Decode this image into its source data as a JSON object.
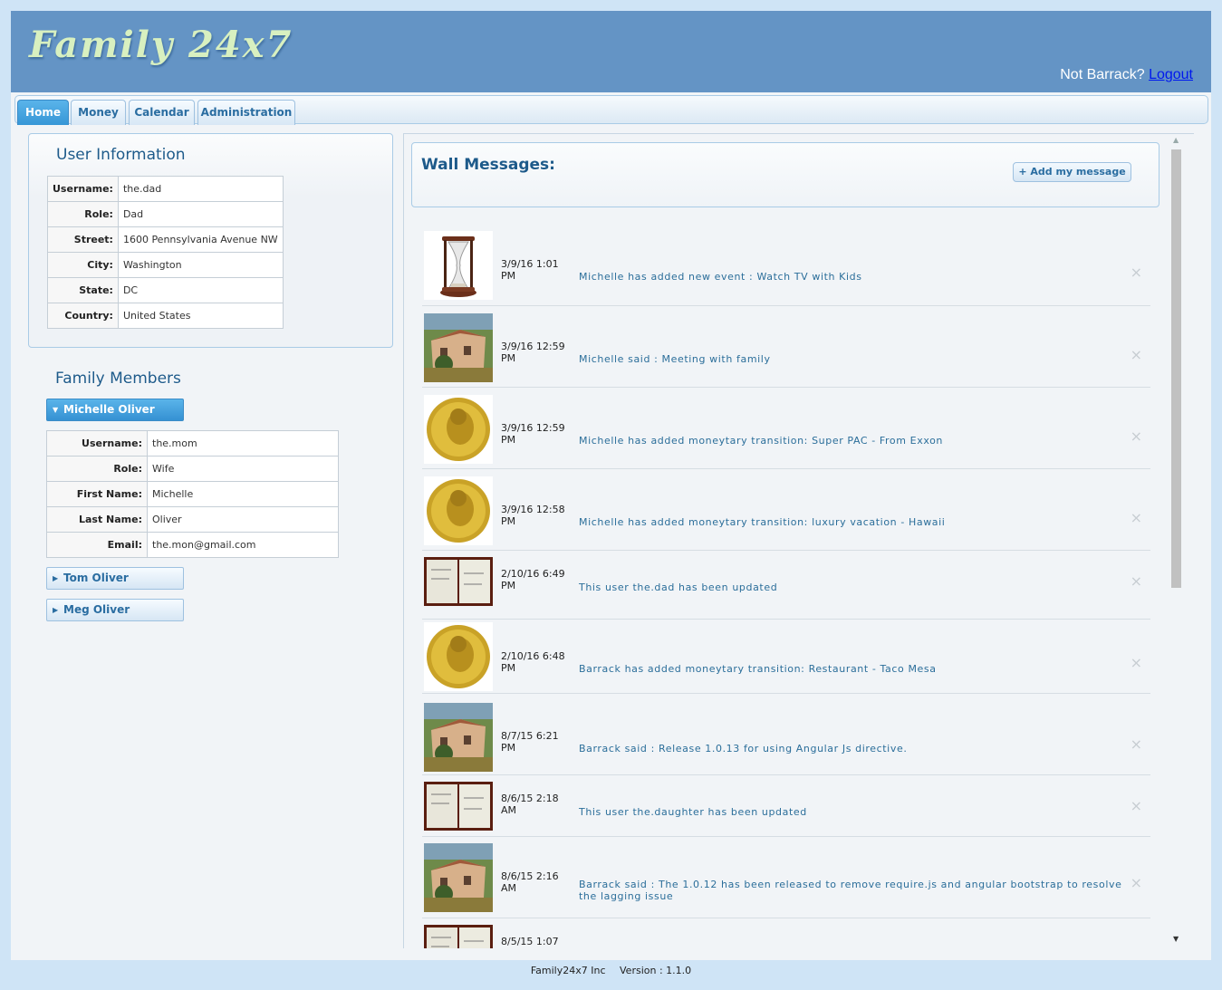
{
  "header": {
    "logo": "Family 24x7",
    "not_user_text": "Not Barrack?",
    "logout_label": "Logout"
  },
  "tabs": [
    {
      "label": "Home",
      "active": true
    },
    {
      "label": "Money",
      "active": false
    },
    {
      "label": "Calendar",
      "active": false
    },
    {
      "label": "Administration",
      "active": false
    }
  ],
  "user_info": {
    "title": "User Information",
    "rows": [
      {
        "key": "Username:",
        "value": "the.dad"
      },
      {
        "key": "Role:",
        "value": "Dad"
      },
      {
        "key": "Street:",
        "value": "1600 Pennsylvania Avenue NW"
      },
      {
        "key": "City:",
        "value": "Washington"
      },
      {
        "key": "State:",
        "value": "DC"
      },
      {
        "key": "Country:",
        "value": "United States"
      }
    ]
  },
  "family": {
    "title": "Family Members",
    "members": [
      {
        "name": "Michelle Oliver",
        "expanded": true,
        "details": [
          {
            "key": "Username:",
            "value": "the.mom"
          },
          {
            "key": "Role:",
            "value": "Wife"
          },
          {
            "key": "First Name:",
            "value": "Michelle"
          },
          {
            "key": "Last Name:",
            "value": "Oliver"
          },
          {
            "key": "Email:",
            "value": "the.mon@gmail.com"
          }
        ]
      },
      {
        "name": "Tom Oliver",
        "expanded": false
      },
      {
        "name": "Meg Oliver",
        "expanded": false
      }
    ]
  },
  "wall": {
    "title": "Wall Messages:",
    "add_label": "+ Add my message",
    "messages": [
      {
        "icon": "hourglass-image",
        "time1": "3/9/16 1:01",
        "time2": "PM",
        "text": "Michelle has added new event : Watch TV with Kids"
      },
      {
        "icon": "painting-image",
        "time1": "3/9/16 12:59",
        "time2": "PM",
        "text": "Michelle said : Meeting with family"
      },
      {
        "icon": "gold-coin-image",
        "time1": "3/9/16 12:59",
        "time2": "PM",
        "text": "Michelle has added moneytary transition: Super PAC - From Exxon"
      },
      {
        "icon": "gold-coin-image",
        "time1": "3/9/16 12:58",
        "time2": "PM",
        "text": "Michelle has added moneytary transition: luxury vacation - Hawaii"
      },
      {
        "icon": "notebook-image",
        "time1": "2/10/16 6:49",
        "time2": "PM",
        "text": "This user the.dad has been updated"
      },
      {
        "icon": "gold-coin-image",
        "time1": "2/10/16 6:48",
        "time2": "PM",
        "text": "Barrack has added moneytary transition: Restaurant - Taco Mesa"
      },
      {
        "icon": "painting-image",
        "time1": "8/7/15 6:21",
        "time2": "PM",
        "text": "Barrack said : Release 1.0.13 for using Angular Js directive."
      },
      {
        "icon": "notebook-image",
        "time1": "8/6/15 2:18",
        "time2": "AM",
        "text": "This user the.daughter has been updated"
      },
      {
        "icon": "painting-image",
        "time1": "8/6/15 2:16",
        "time2": "AM",
        "text": "Barrack said : The 1.0.12 has been released to remove require.js and angular bootstrap to resolve the lagging issue"
      },
      {
        "icon": "notebook-image",
        "time1": "8/5/15 1:07",
        "time2": "",
        "text": ""
      }
    ],
    "close_glyph": "×"
  },
  "footer": {
    "company": "Family24x7 Inc",
    "version": "Version : 1.1.0"
  }
}
